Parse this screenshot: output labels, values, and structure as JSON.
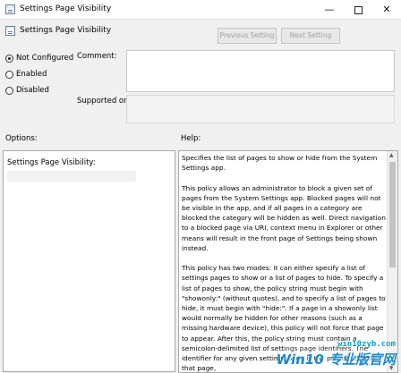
{
  "window": {
    "title": "Settings Page Visibility",
    "minimize_glyph": "—",
    "close_glyph": "✕"
  },
  "header": {
    "policy_title": "Settings Page Visibility",
    "previous_label": "Previous Setting",
    "next_label": "Next Setting"
  },
  "state": {
    "options": [
      {
        "label": "Not Configured",
        "checked": true
      },
      {
        "label": "Enabled",
        "checked": false
      },
      {
        "label": "Disabled",
        "checked": false
      }
    ]
  },
  "fields": {
    "comment_label": "Comment:",
    "comment_value": "",
    "supported_label": "Supported on:",
    "supported_value": ""
  },
  "sections": {
    "options_label": "Options:",
    "help_label": "Help:"
  },
  "options_pane": {
    "field_label": "Settings Page Visibility:",
    "field_value": ""
  },
  "help": {
    "paragraphs": [
      "Specifies the list of pages to show or hide from the System Settings app.",
      "This policy allows an administrator to block a given set of pages from the System Settings app. Blocked pages will not be visible in the app, and if all pages in a category are blocked the category will be hidden as well. Direct navigation to a blocked page via URI, context menu in Explorer or other means will result in the front page of Settings being shown instead.",
      "This policy has two modes: it can either specify a list of settings pages to show or a list of pages to hide. To specify a list of pages to show, the policy string must begin with \"showonly:\" (without quotes), and to specify a list of pages to hide, it must begin with \"hide:\". If a page in a showonly list would normally be hidden for other reasons (such as a missing hardware device), this policy will not force that page to appear. After this, the policy string must contain a semicolon-delimited list of settings page identifiers. The identifier for any given settings page is the published URI for that page,"
    ]
  },
  "watermark": {
    "url": "win10zyb.com",
    "brand": "Win10 专业版官网"
  },
  "icons": {
    "app": "policy-document-icon",
    "scroll_up": "▲",
    "scroll_down": "▼"
  },
  "colors": {
    "window_bg": "#f0f0f0",
    "watermark_blue": "#1e88c9"
  }
}
